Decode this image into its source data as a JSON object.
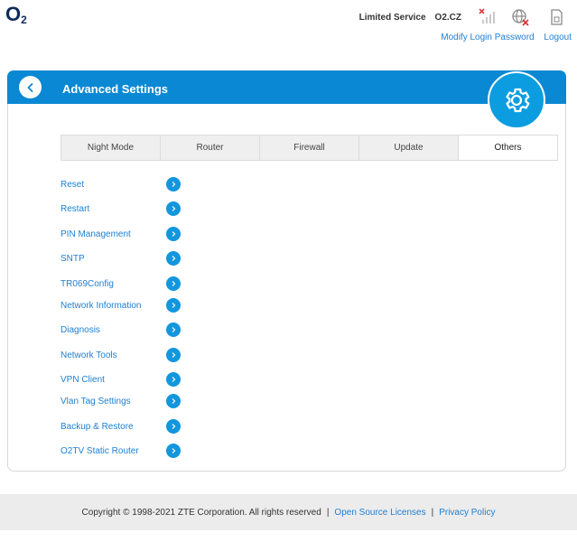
{
  "brand": {
    "logo_main": "O",
    "logo_sub": "2"
  },
  "status": {
    "service_text": "Limited Service",
    "carrier": "O2.CZ",
    "icons": [
      "signal-off-icon",
      "network-off-icon",
      "sim-card-icon"
    ]
  },
  "header_links": {
    "modify_password": "Modify Login Password",
    "logout": "Logout"
  },
  "banner": {
    "title": "Advanced Settings"
  },
  "tabs": [
    {
      "label": "Night Mode",
      "active": false
    },
    {
      "label": "Router",
      "active": false
    },
    {
      "label": "Firewall",
      "active": false
    },
    {
      "label": "Update",
      "active": false
    },
    {
      "label": "Others",
      "active": true
    }
  ],
  "menu": [
    {
      "label": "Reset"
    },
    {
      "label": "Restart"
    },
    {
      "label": "PIN Management"
    },
    {
      "label": "SNTP"
    },
    {
      "label": "TR069Config"
    },
    {
      "label": "Network Information"
    },
    {
      "label": "Diagnosis"
    },
    {
      "label": "Network Tools"
    },
    {
      "label": "VPN Client"
    },
    {
      "label": "Vlan Tag Settings"
    },
    {
      "label": "Backup & Restore"
    },
    {
      "label": "O2TV Static Router"
    }
  ],
  "footer": {
    "copyright": "Copyright © 1998-2021 ZTE Corporation. All rights reserved",
    "separator": "|",
    "open_source": "Open Source Licenses",
    "privacy": "Privacy Policy"
  },
  "colors": {
    "accent": "#0b88d3",
    "link": "#1f7fd1",
    "brand": "#0f2b5b"
  }
}
